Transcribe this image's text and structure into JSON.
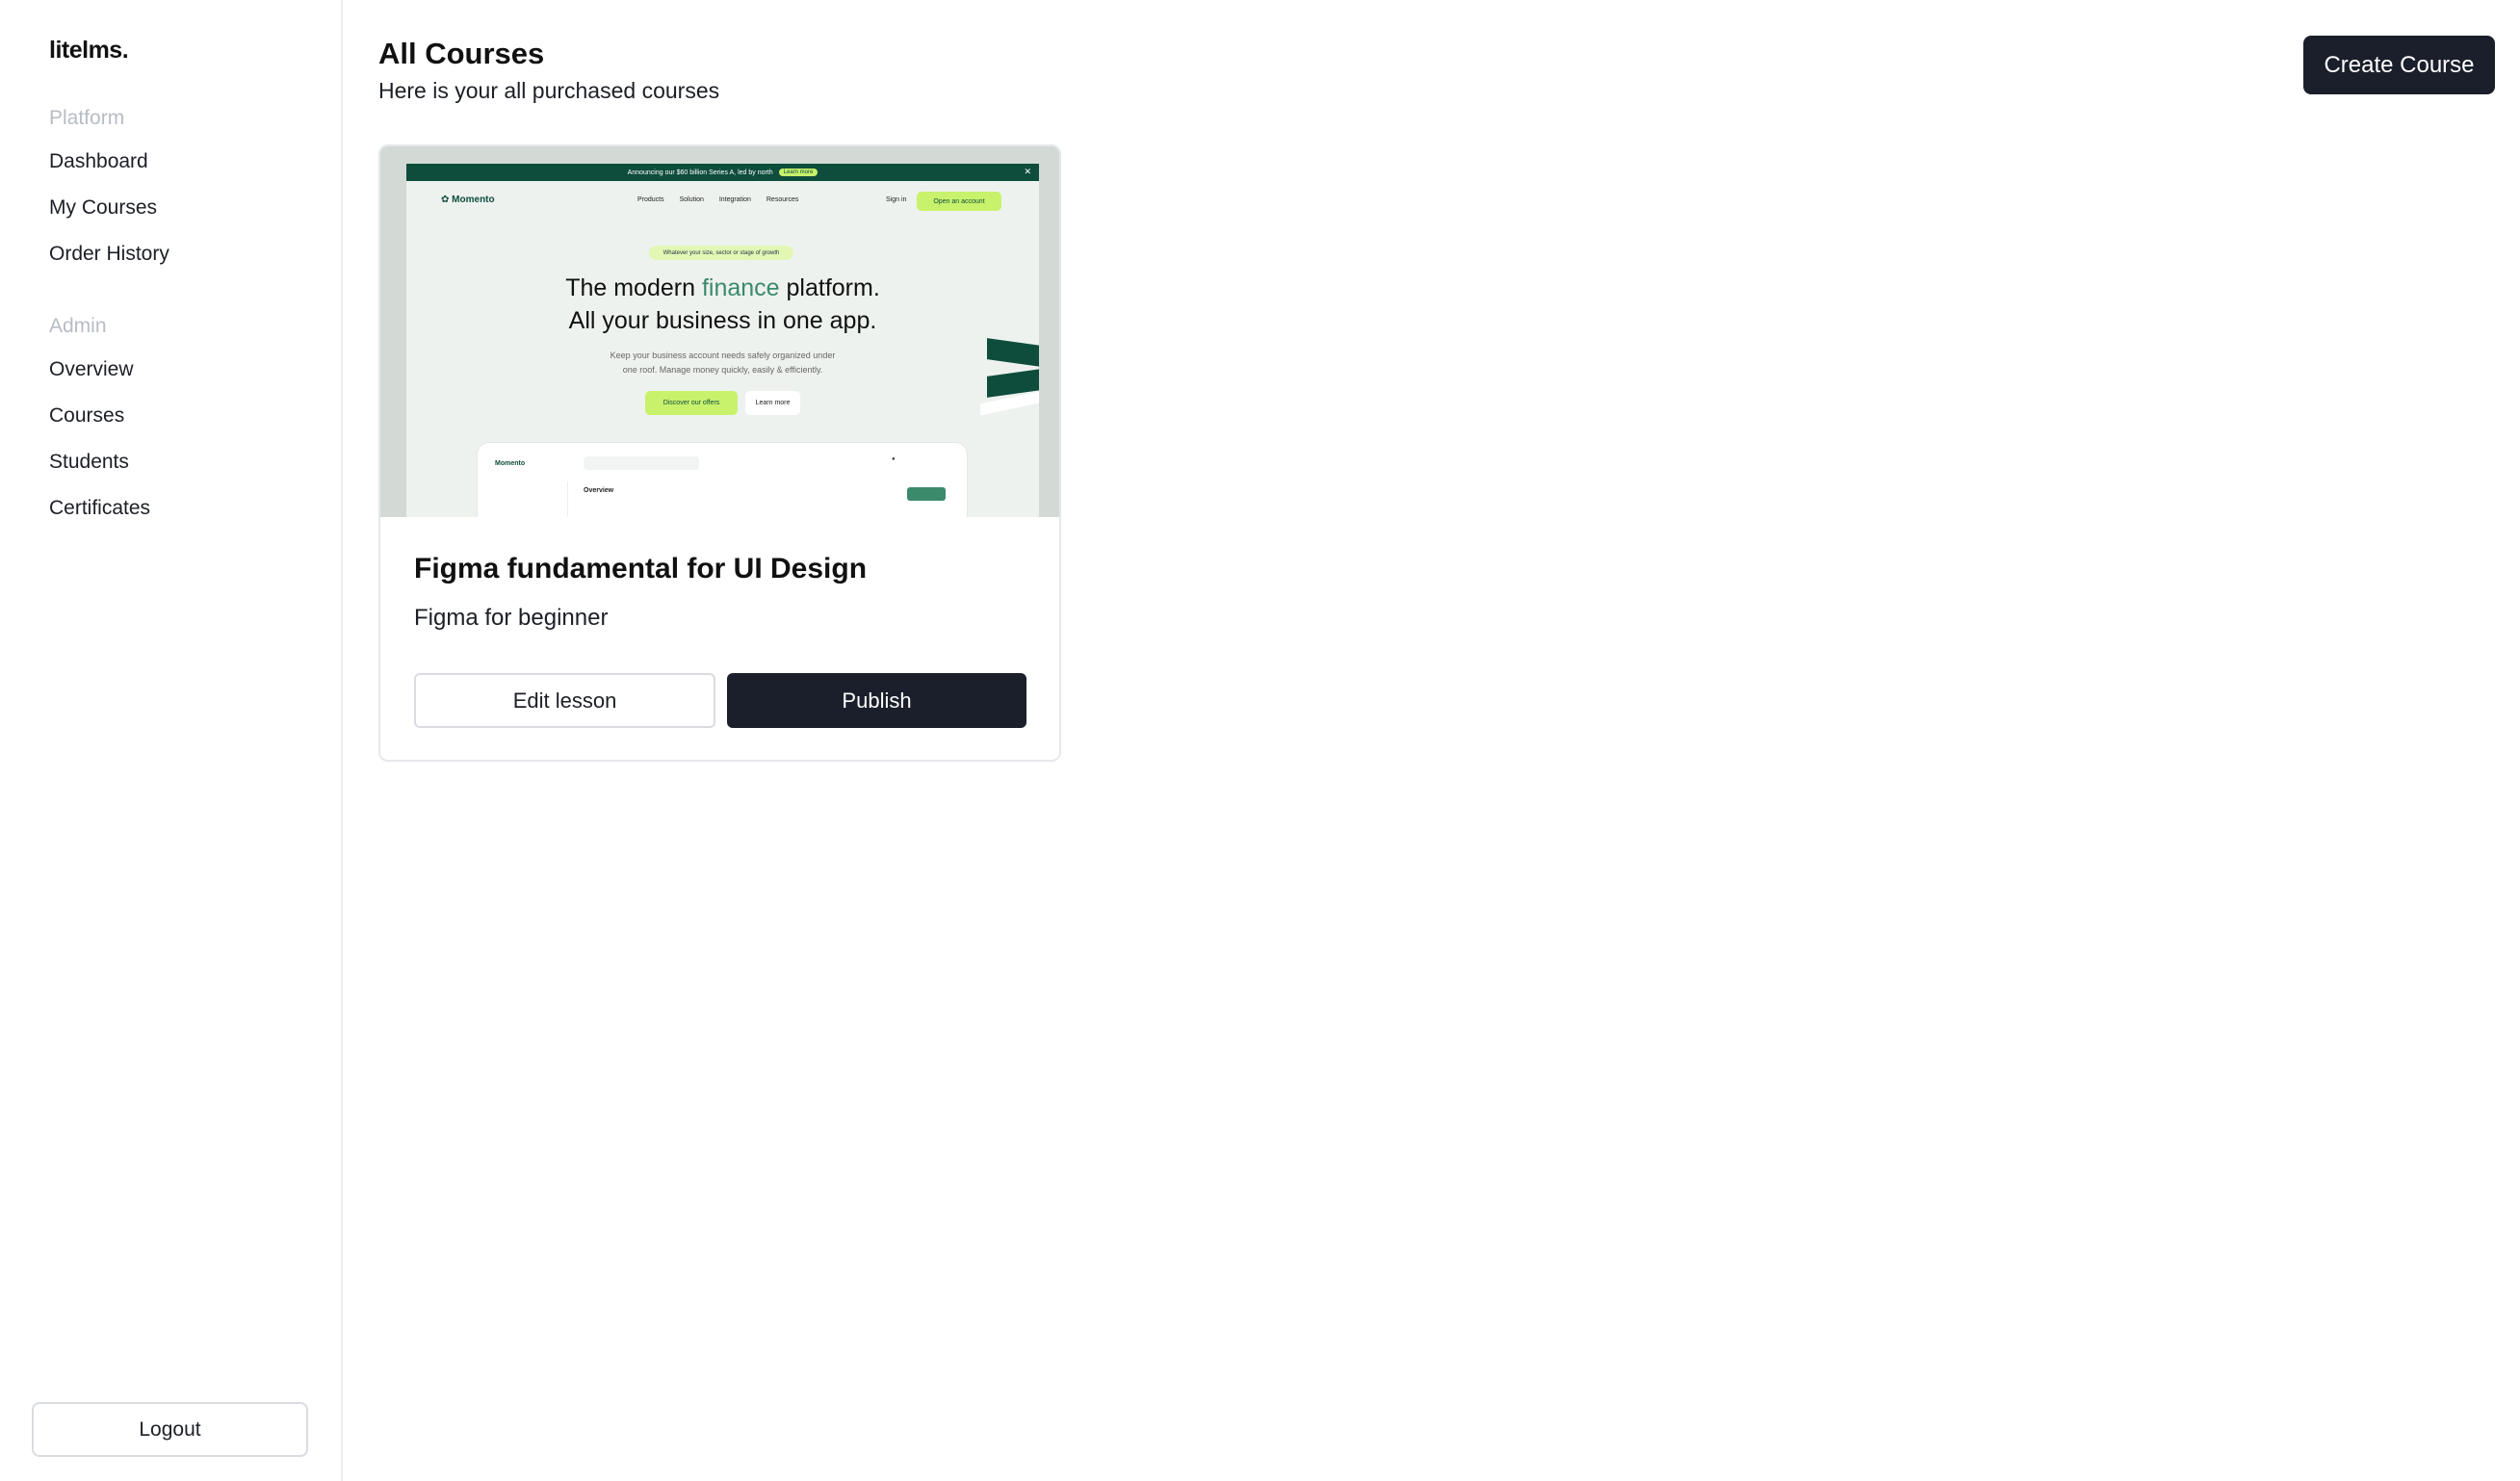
{
  "app": {
    "logo": "litelms."
  },
  "sidebar": {
    "groups": [
      {
        "label": "Platform",
        "items": [
          {
            "label": "Dashboard"
          },
          {
            "label": "My Courses"
          },
          {
            "label": "Order History"
          }
        ]
      },
      {
        "label": "Admin",
        "items": [
          {
            "label": "Overview"
          },
          {
            "label": "Courses"
          },
          {
            "label": "Students"
          },
          {
            "label": "Certificates"
          }
        ]
      }
    ],
    "logout_label": "Logout"
  },
  "header": {
    "title": "All Courses",
    "subtitle": "Here is your all purchased courses",
    "create_label": "Create Course"
  },
  "courses": [
    {
      "title": "Figma fundamental for UI Design",
      "subtitle": "Figma for beginner",
      "edit_label": "Edit lesson",
      "publish_label": "Publish",
      "thumbnail": {
        "announcement": "Announcing our $60 billion Series A, led by north",
        "announcement_badge": "Learn more",
        "brand": "Momento",
        "nav_links": [
          "Products",
          "Solution",
          "Integration",
          "Resources"
        ],
        "sign_in": "Sign in",
        "open_account": "Open an account",
        "tagline": "Whatever your size, sector or stage of growth",
        "headline_prefix": "The modern ",
        "headline_accent": "finance",
        "headline_suffix": " platform.",
        "headline_line2": "All your business in one app.",
        "description_line1": "Keep your business account needs safely organized under",
        "description_line2": "one roof. Manage money quickly, easily & efficiently.",
        "cta_primary": "Discover our offers",
        "cta_secondary": "Learn more",
        "dashboard_brand": "Momento",
        "dashboard_section": "Overview"
      }
    }
  ],
  "colors": {
    "primary_dark": "#1a1f2b",
    "muted_label": "#b7bcc5",
    "border": "#d9dce1",
    "thumb_green": "#0e4d3c",
    "thumb_lime": "#c8f26b"
  }
}
